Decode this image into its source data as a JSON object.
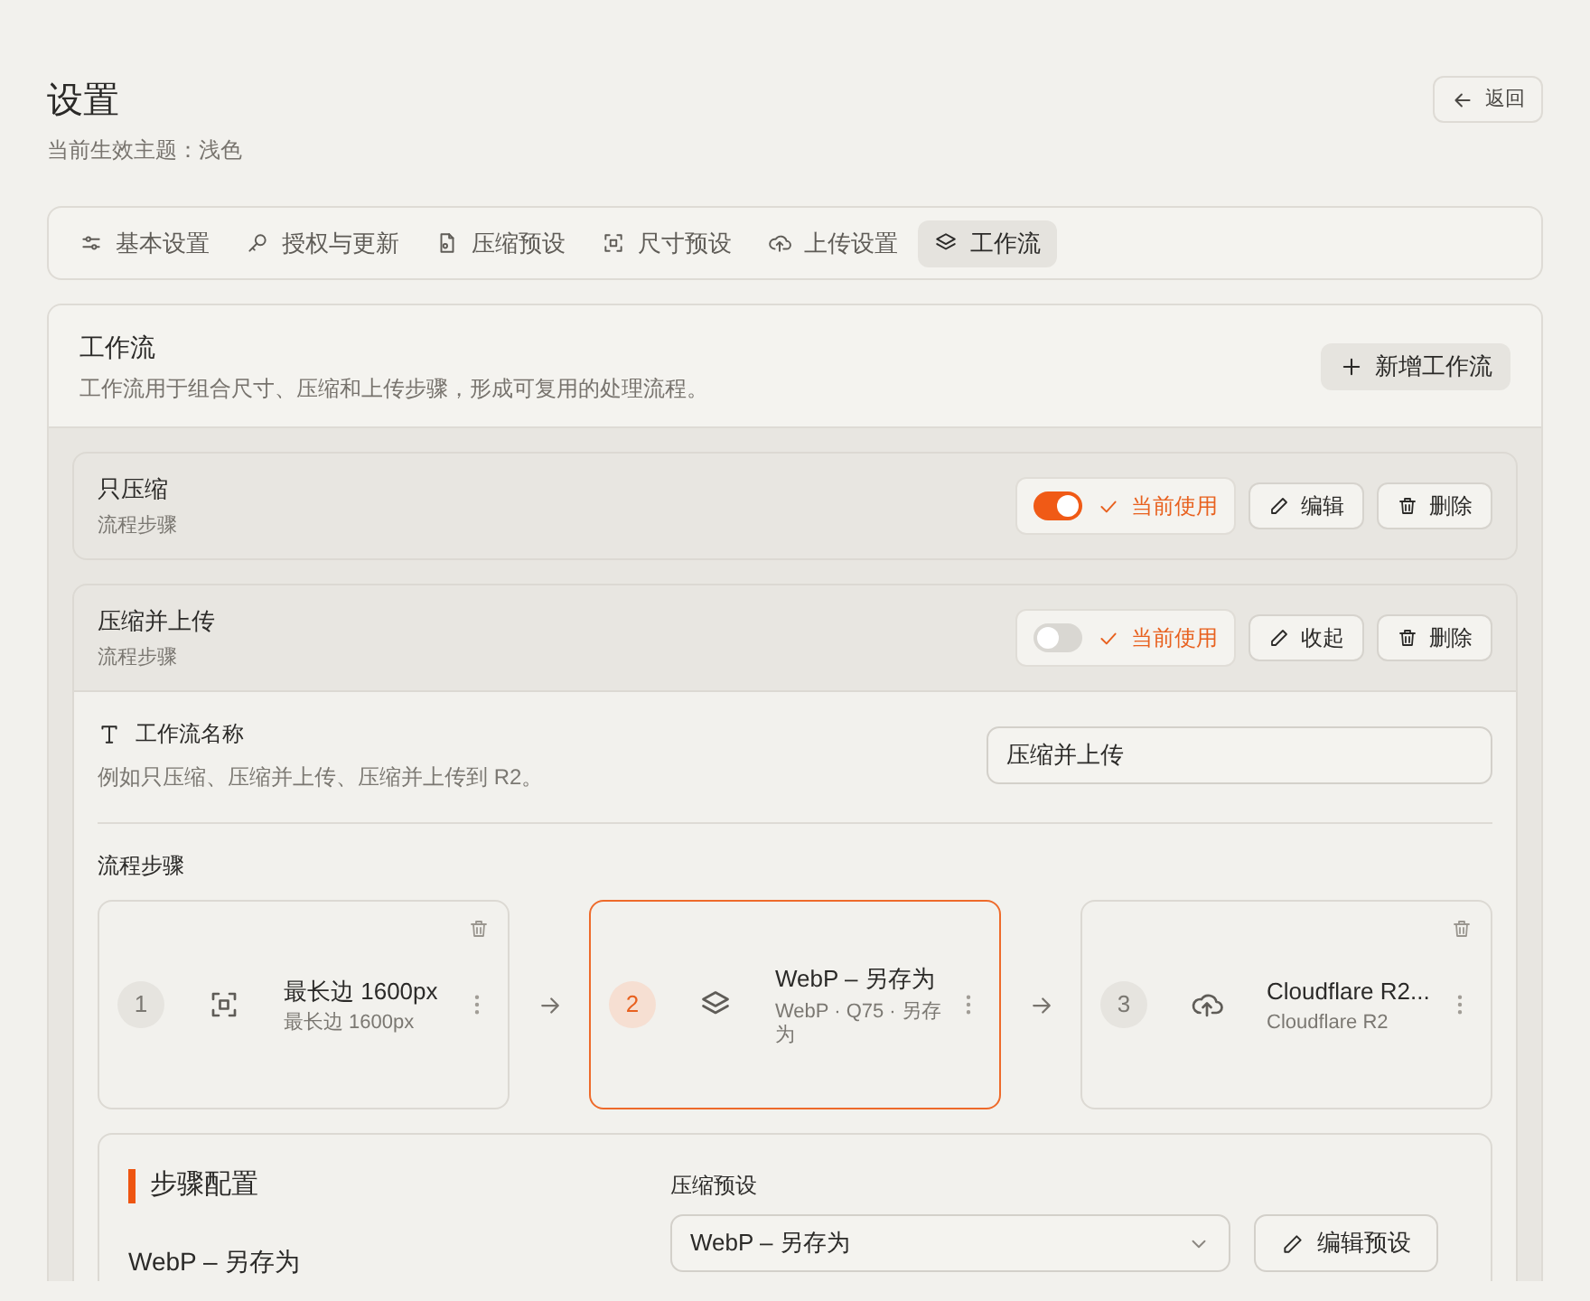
{
  "header": {
    "title": "设置",
    "subtitle": "当前生效主题：浅色",
    "back_button": "返回"
  },
  "tabs": [
    {
      "label": "基本设置",
      "selected": false
    },
    {
      "label": "授权与更新",
      "selected": false
    },
    {
      "label": "压缩预设",
      "selected": false
    },
    {
      "label": "尺寸预设",
      "selected": false
    },
    {
      "label": "上传设置",
      "selected": false
    },
    {
      "label": "工作流",
      "selected": true
    }
  ],
  "section": {
    "title": "工作流",
    "description": "工作流用于组合尺寸、压缩和上传步骤，形成可复用的处理流程。",
    "add_button": "新增工作流"
  },
  "workflows": [
    {
      "name": "只压缩",
      "subtitle": "流程步骤",
      "active": true,
      "active_label": "当前使用",
      "edit_button": "编辑",
      "delete_button": "删除",
      "expanded": false
    },
    {
      "name": "压缩并上传",
      "subtitle": "流程步骤",
      "active": false,
      "active_label": "当前使用",
      "edit_button": "收起",
      "delete_button": "删除",
      "expanded": true
    }
  ],
  "editor": {
    "name_label": "工作流名称",
    "name_hint": "例如只压缩、压缩并上传、压缩并上传到 R2。",
    "name_value": "压缩并上传",
    "steps_label": "流程步骤",
    "steps": [
      {
        "kind": "resize",
        "number": "1",
        "title": "最长边 1600px",
        "detail": "最长边 1600px",
        "selected": false
      },
      {
        "kind": "compress",
        "number": "2",
        "title": "WebP – 另存为",
        "detail": "WebP · Q75 · 另存为",
        "selected": true
      },
      {
        "kind": "upload",
        "number": "3",
        "title": "Cloudflare R2...",
        "detail": "Cloudflare R2",
        "selected": false
      }
    ],
    "config": {
      "title": "步骤配置",
      "step_name": "WebP – 另存为",
      "preset_label": "压缩预设",
      "preset_value": "WebP – 另存为",
      "edit_preset_button": "编辑预设"
    }
  }
}
